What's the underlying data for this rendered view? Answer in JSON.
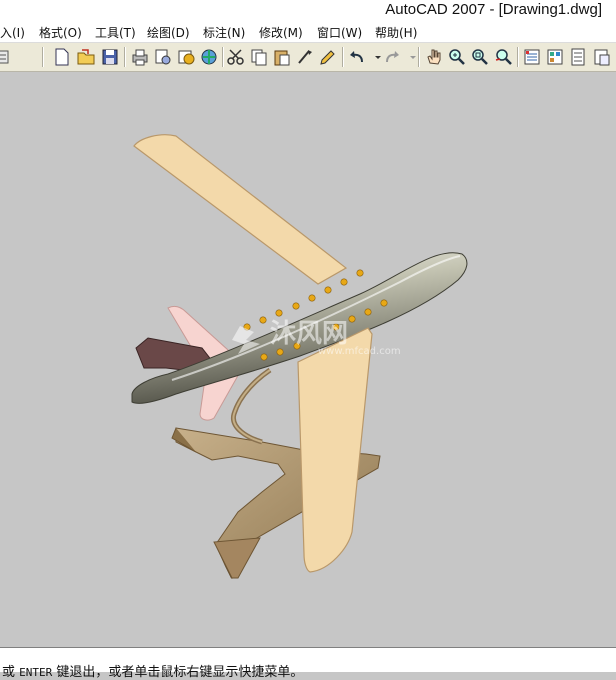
{
  "window": {
    "title": "AutoCAD 2007 - [Drawing1.dwg]"
  },
  "menu": [
    {
      "label": "入(I)"
    },
    {
      "label": "格式(O)"
    },
    {
      "label": "工具(T)"
    },
    {
      "label": "绘图(D)"
    },
    {
      "label": "标注(N)"
    },
    {
      "label": "修改(M)"
    },
    {
      "label": "窗口(W)"
    },
    {
      "label": "帮助(H)"
    }
  ],
  "toolbar": {
    "icons": [
      "layer-icon",
      "new-icon",
      "open-icon",
      "save-icon",
      "plot-icon",
      "plot-preview-icon",
      "publish-icon",
      "3d-dwf-icon",
      "cut-icon",
      "copy-icon",
      "paste-icon",
      "match-properties-icon",
      "block-editor-icon",
      "undo-icon",
      "redo-icon",
      "pan-icon",
      "zoom-realtime-icon",
      "zoom-window-icon",
      "zoom-previous-icon",
      "properties-icon",
      "design-center-icon",
      "tool-palettes-icon"
    ]
  },
  "watermark": {
    "brand": "沐风网",
    "url": "www.mfcad.com"
  },
  "command": {
    "prefix": "或",
    "key": "ENTER",
    "rest": "键退出，或者单击鼠标右键显示快捷菜单。"
  },
  "colors": {
    "background": "#c6c6c6",
    "wing": "#f3d9aa",
    "fuselage": "#8c8c7a",
    "stand": "#b59a6e"
  }
}
